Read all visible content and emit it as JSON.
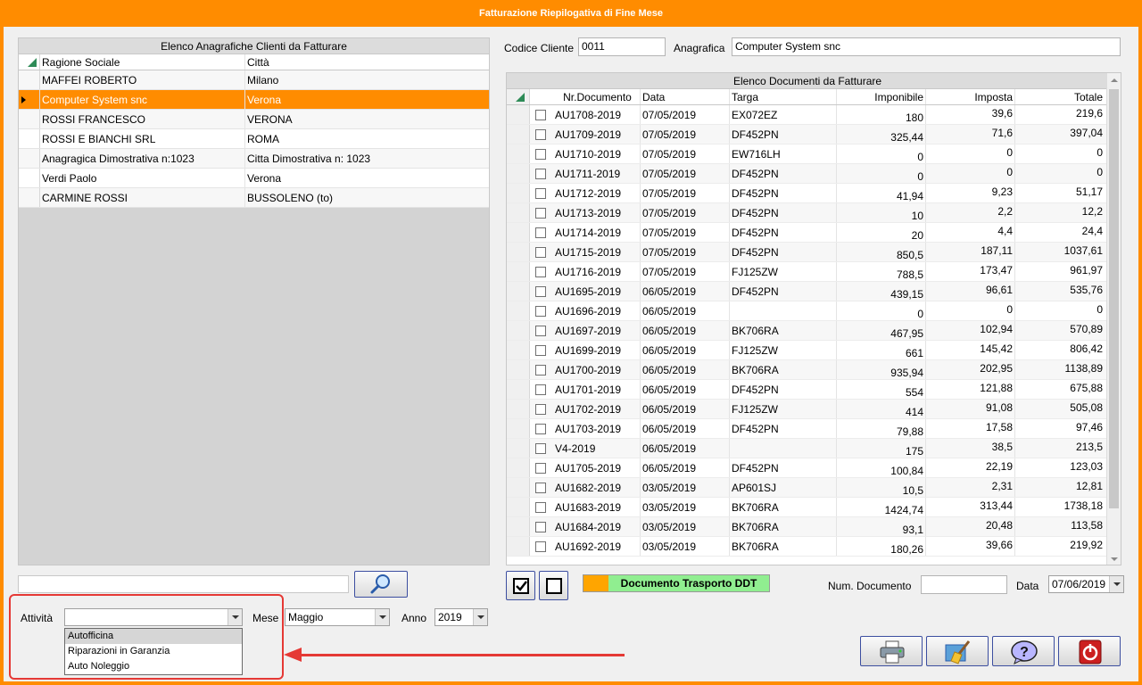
{
  "window": {
    "title": "Fatturazione Riepilogativa di Fine Mese"
  },
  "clients_grid": {
    "caption": "Elenco Anagrafiche Clienti da Fatturare",
    "columns": [
      "Ragione Sociale",
      "Città"
    ],
    "rows": [
      {
        "name": "MAFFEI ROBERTO",
        "city": "Milano"
      },
      {
        "name": "Computer System snc",
        "city": "Verona",
        "selected": true
      },
      {
        "name": "ROSSI FRANCESCO",
        "city": "VERONA"
      },
      {
        "name": "ROSSI E BIANCHI SRL",
        "city": "ROMA"
      },
      {
        "name": "Anagragica Dimostrativa n:1023",
        "city": "Citta Dimostrativa n: 1023"
      },
      {
        "name": "Verdi Paolo",
        "city": "Verona"
      },
      {
        "name": "CARMINE ROSSI",
        "city": "BUSSOLENO (to)"
      }
    ]
  },
  "search": {
    "value": ""
  },
  "filters": {
    "attivita_label": "Attività",
    "attivita_value": "",
    "attivita_options": [
      "Autofficina",
      "Riparazioni in Garanzia",
      "Auto Noleggio"
    ],
    "mese_label": "Mese",
    "mese_value": "Maggio",
    "anno_label": "Anno",
    "anno_value": "2019"
  },
  "header_fields": {
    "codice_label": "Codice Cliente",
    "codice_value": "0011",
    "anagrafica_label": "Anagrafica",
    "anagrafica_value": "Computer System snc"
  },
  "documents_grid": {
    "caption": "Elenco Documenti da Fatturare",
    "columns": [
      "Nr.Documento",
      "Data",
      "Targa",
      "Imponibile",
      "Imposta",
      "Totale"
    ],
    "rows": [
      [
        "AU1708-2019",
        "07/05/2019",
        "EX072EZ",
        "180",
        "39,6",
        "219,6"
      ],
      [
        "AU1709-2019",
        "07/05/2019",
        "DF452PN",
        "325,44",
        "71,6",
        "397,04"
      ],
      [
        "AU1710-2019",
        "07/05/2019",
        "EW716LH",
        "0",
        "0",
        "0"
      ],
      [
        "AU1711-2019",
        "07/05/2019",
        "DF452PN",
        "0",
        "0",
        "0"
      ],
      [
        "AU1712-2019",
        "07/05/2019",
        "DF452PN",
        "41,94",
        "9,23",
        "51,17"
      ],
      [
        "AU1713-2019",
        "07/05/2019",
        "DF452PN",
        "10",
        "2,2",
        "12,2"
      ],
      [
        "AU1714-2019",
        "07/05/2019",
        "DF452PN",
        "20",
        "4,4",
        "24,4"
      ],
      [
        "AU1715-2019",
        "07/05/2019",
        "DF452PN",
        "850,5",
        "187,11",
        "1037,61"
      ],
      [
        "AU1716-2019",
        "07/05/2019",
        "FJ125ZW",
        "788,5",
        "173,47",
        "961,97"
      ],
      [
        "AU1695-2019",
        "06/05/2019",
        "DF452PN",
        "439,15",
        "96,61",
        "535,76"
      ],
      [
        "AU1696-2019",
        "06/05/2019",
        "",
        "0",
        "0",
        "0"
      ],
      [
        "AU1697-2019",
        "06/05/2019",
        "BK706RA",
        "467,95",
        "102,94",
        "570,89"
      ],
      [
        "AU1699-2019",
        "06/05/2019",
        "FJ125ZW",
        "661",
        "145,42",
        "806,42"
      ],
      [
        "AU1700-2019",
        "06/05/2019",
        "BK706RA",
        "935,94",
        "202,95",
        "1138,89"
      ],
      [
        "AU1701-2019",
        "06/05/2019",
        "DF452PN",
        "554",
        "121,88",
        "675,88"
      ],
      [
        "AU1702-2019",
        "06/05/2019",
        "FJ125ZW",
        "414",
        "91,08",
        "505,08"
      ],
      [
        "AU1703-2019",
        "06/05/2019",
        "DF452PN",
        "79,88",
        "17,58",
        "97,46"
      ],
      [
        "V4-2019",
        "06/05/2019",
        "",
        "175",
        "38,5",
        "213,5"
      ],
      [
        "AU1705-2019",
        "06/05/2019",
        "DF452PN",
        "100,84",
        "22,19",
        "123,03"
      ],
      [
        "AU1682-2019",
        "03/05/2019",
        "AP601SJ",
        "10,5",
        "2,31",
        "12,81"
      ],
      [
        "AU1683-2019",
        "03/05/2019",
        "BK706RA",
        "1424,74",
        "313,44",
        "1738,18"
      ],
      [
        "AU1684-2019",
        "03/05/2019",
        "BK706RA",
        "93,1",
        "20,48",
        "113,58"
      ],
      [
        "AU1692-2019",
        "03/05/2019",
        "BK706RA",
        "180,26",
        "39,66",
        "219,92"
      ]
    ]
  },
  "bottom": {
    "ddt_label": "Documento Trasporto DDT",
    "num_doc_label": "Num. Documento",
    "num_doc_value": "",
    "data_label": "Data",
    "data_value": "07/06/2019"
  },
  "colors": {
    "accent": "#ff8c00",
    "ddt_green": "#90ee90",
    "highlight_red": "#e53935"
  },
  "icons": [
    "search-icon",
    "check-all-icon",
    "uncheck-all-icon",
    "printer-icon",
    "broom-icon",
    "help-icon",
    "power-icon"
  ]
}
